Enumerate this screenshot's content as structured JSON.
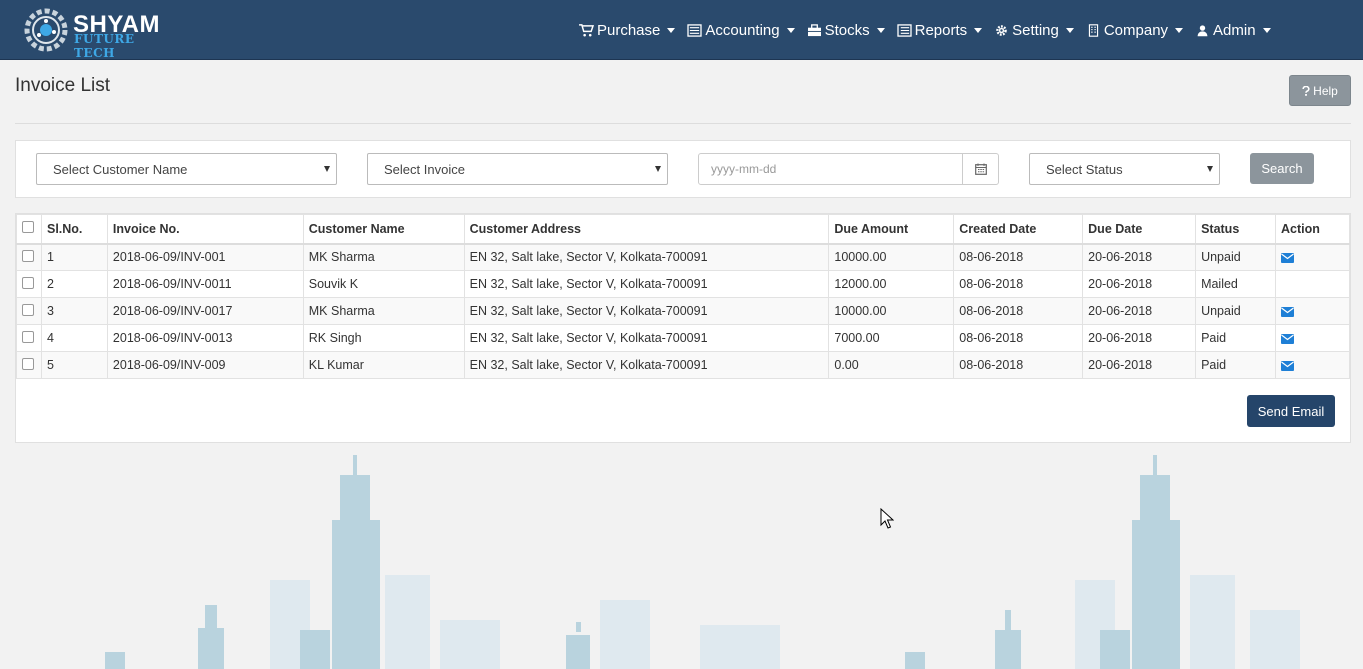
{
  "brand": {
    "name": "SHYAM",
    "sub": "FUTURE TECH"
  },
  "nav": [
    {
      "label": "Purchase",
      "icon": "cart-icon"
    },
    {
      "label": "Accounting",
      "icon": "list-alt-icon"
    },
    {
      "label": "Stocks",
      "icon": "briefcase-icon"
    },
    {
      "label": "Reports",
      "icon": "list-icon"
    },
    {
      "label": "Setting",
      "icon": "gear-icon"
    },
    {
      "label": "Company",
      "icon": "building-icon"
    },
    {
      "label": "Admin",
      "icon": "user-icon"
    }
  ],
  "page": {
    "title": "Invoice List",
    "help_label": "Help"
  },
  "filters": {
    "customer_placeholder": "Select Customer Name",
    "invoice_placeholder": "Select Invoice",
    "date_placeholder": "yyyy-mm-dd",
    "status_placeholder": "Select Status",
    "search_label": "Search"
  },
  "table": {
    "columns": [
      "Sl.No.",
      "Invoice No.",
      "Customer Name",
      "Customer Address",
      "Due Amount",
      "Created Date",
      "Due Date",
      "Status",
      "Action"
    ],
    "rows": [
      {
        "sl": "1",
        "invoice": "2018-06-09/INV-001",
        "customer": "MK Sharma",
        "address": "EN 32, Salt lake, Sector V, Kolkata-700091",
        "due_amount": "10000.00",
        "created": "08-06-2018",
        "due_date": "20-06-2018",
        "status": "Unpaid",
        "action_icon": "envelope-icon"
      },
      {
        "sl": "2",
        "invoice": "2018-06-09/INV-0011",
        "customer": "Souvik K",
        "address": "EN 32, Salt lake, Sector V, Kolkata-700091",
        "due_amount": "12000.00",
        "created": "08-06-2018",
        "due_date": "20-06-2018",
        "status": "Mailed",
        "action_icon": ""
      },
      {
        "sl": "3",
        "invoice": "2018-06-09/INV-0017",
        "customer": "MK Sharma",
        "address": "EN 32, Salt lake, Sector V, Kolkata-700091",
        "due_amount": "10000.00",
        "created": "08-06-2018",
        "due_date": "20-06-2018",
        "status": "Unpaid",
        "action_icon": "envelope-icon"
      },
      {
        "sl": "4",
        "invoice": "2018-06-09/INV-0013",
        "customer": "RK Singh",
        "address": "EN 32, Salt lake, Sector V, Kolkata-700091",
        "due_amount": "7000.00",
        "created": "08-06-2018",
        "due_date": "20-06-2018",
        "status": "Paid",
        "action_icon": "envelope-icon"
      },
      {
        "sl": "5",
        "invoice": "2018-06-09/INV-009",
        "customer": "KL Kumar",
        "address": "EN 32, Salt lake, Sector V, Kolkata-700091",
        "due_amount": "0.00",
        "created": "08-06-2018",
        "due_date": "20-06-2018",
        "status": "Paid",
        "action_icon": "envelope-icon"
      }
    ],
    "send_email_label": "Send Email"
  },
  "colors": {
    "nav_bg": "#2a4a6d",
    "accent_blue": "#1e7fd6",
    "button_gray": "#8c959c",
    "send_button": "#25456a"
  }
}
